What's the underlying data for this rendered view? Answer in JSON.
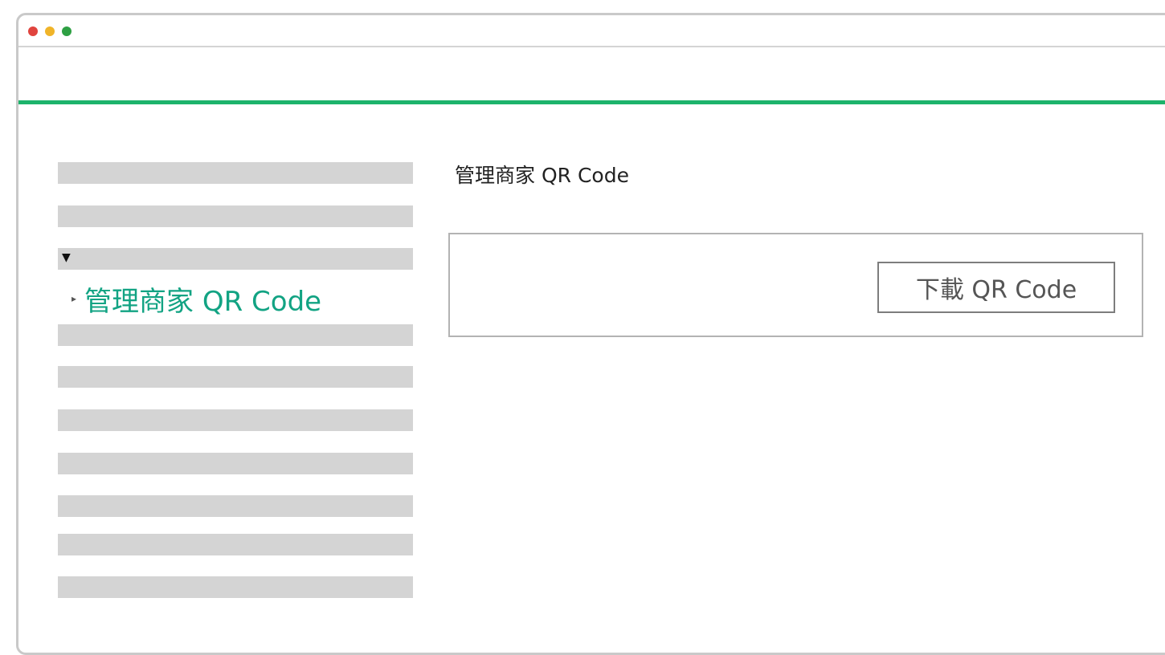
{
  "window": {
    "controls": [
      {
        "name": "close-dot",
        "color": "#e0443e"
      },
      {
        "name": "minimize-dot",
        "color": "#f0b429"
      },
      {
        "name": "maximize-dot",
        "color": "#2ea043"
      }
    ]
  },
  "header": {
    "accent_color": "#1db36b"
  },
  "sidebar": {
    "expand_icon": "▼",
    "active_icon": "▸",
    "active_item_label": "管理商家 QR Code",
    "active_color": "#12a383",
    "placeholder_color": "#d4d4d4"
  },
  "main": {
    "page_title": "管理商家 QR Code",
    "download_button_label": "下載 QR Code"
  }
}
